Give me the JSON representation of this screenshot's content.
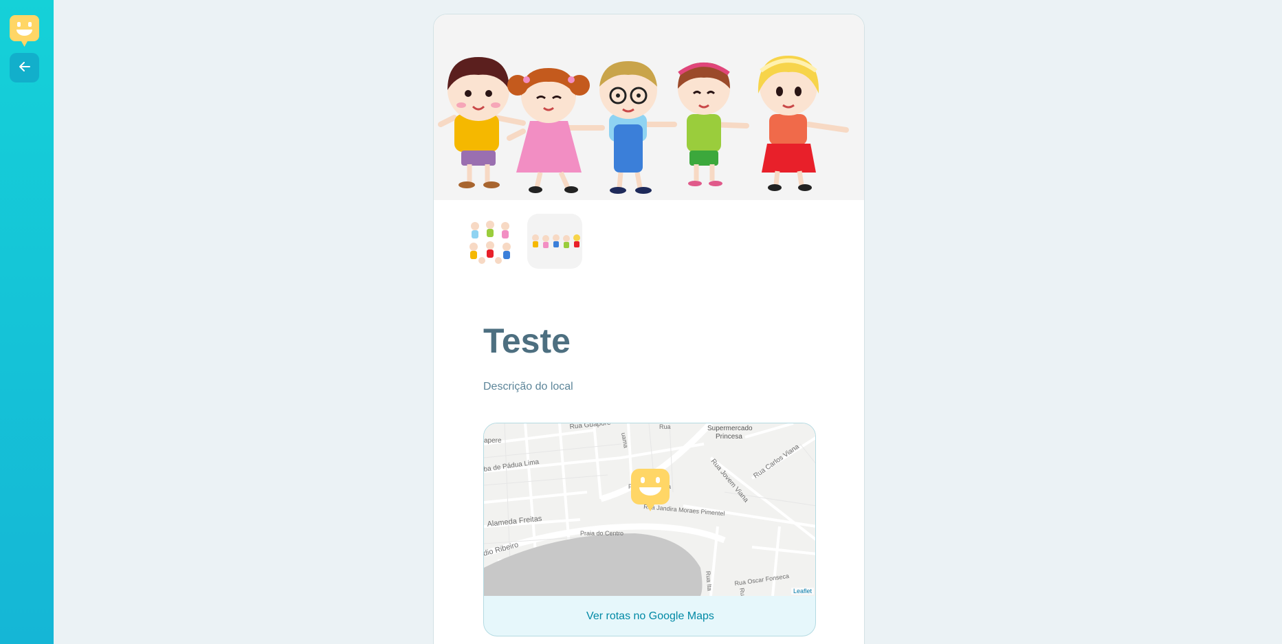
{
  "sidebar": {
    "logo_icon": "happy-face-chat-icon",
    "back_button_icon": "arrow-left-icon"
  },
  "place": {
    "title": "Teste",
    "description": "Descrição do local",
    "images": [
      {
        "name": "children-group-illustration"
      },
      {
        "name": "children-holding-hands-illustration"
      }
    ],
    "active_image": 1
  },
  "map": {
    "streets": [
      "Rua Guaporé",
      "Supermercado",
      "Princesa",
      "Rua Jovem Viana",
      "Rua Carlos Viana",
      "Alameda Freitas",
      "Praia do Centro",
      "Rua Jandira Moraes Pimentel",
      "Rua Oscar Fonseca",
      "dio Ribeiro",
      "ba de Pádua Lima",
      "apere",
      "uama",
      "Rua",
      "Rua Ita",
      "Ru",
      "Pr",
      "iba"
    ],
    "attribution": "Leaflet",
    "routes_link": "Ver rotas no Google Maps"
  },
  "colors": {
    "sidebar_top": "#15d1d8",
    "sidebar_bottom": "#15b6d6",
    "title": "#4d6f80",
    "description": "#5c8599",
    "link": "#0089a5",
    "marker": "#ffd666",
    "background": "#ebf2f5"
  }
}
